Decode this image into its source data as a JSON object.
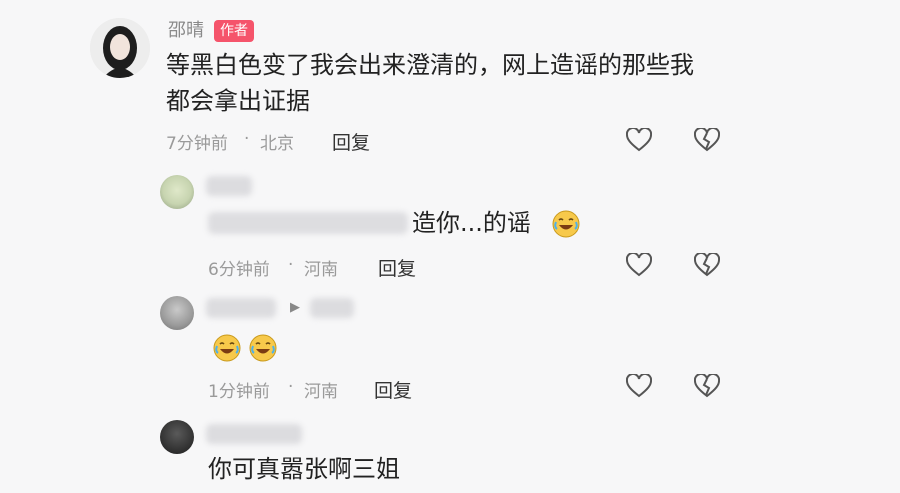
{
  "main_comment": {
    "author": "邵晴",
    "author_badge": "作者",
    "text_line1": "等黑白色变了我会出来澄清的，网上造谣的那些我",
    "text_line2": "都会拿出证据",
    "time": "7分钟前",
    "location": "北京",
    "reply_label": "回复"
  },
  "replies": [
    {
      "text": "造你...的谣",
      "emoji": "laughing-tears-emoji",
      "time": "6分钟前",
      "location": "河南",
      "reply_label": "回复"
    },
    {
      "name_fragment": "▶",
      "emoji": "laughing-tears-emoji",
      "time": "1分钟前",
      "location": "河南",
      "reply_label": "回复"
    },
    {
      "text": "你可真嚣张啊三姐"
    }
  ],
  "icons": {
    "like": "heart-outline-icon",
    "dislike": "broken-heart-icon"
  },
  "colors": {
    "background": "#f7f7f8",
    "author_badge": "#f5546b",
    "meta_text": "#9a9a9a"
  }
}
